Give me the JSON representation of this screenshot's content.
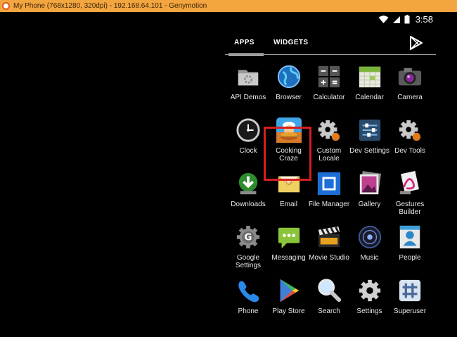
{
  "window": {
    "title": "My Phone (768x1280, 320dpi) - 192.168.64.101 - Genymotion"
  },
  "status_bar": {
    "time": "3:58"
  },
  "tabs": [
    {
      "label": "APPS"
    },
    {
      "label": "WIDGETS"
    }
  ],
  "apps": [
    {
      "label": "API Demos",
      "icon": "folder-icon"
    },
    {
      "label": "Browser",
      "icon": "globe-icon"
    },
    {
      "label": "Calculator",
      "icon": "calculator-icon"
    },
    {
      "label": "Calendar",
      "icon": "calendar-icon"
    },
    {
      "label": "Camera",
      "icon": "camera-icon"
    },
    {
      "label": "Clock",
      "icon": "clock-icon"
    },
    {
      "label": "Cooking Craze",
      "icon": "cooking-craze-icon"
    },
    {
      "label": "Custom Locale",
      "icon": "gear-icon"
    },
    {
      "label": "Dev Settings",
      "icon": "sliders-icon"
    },
    {
      "label": "Dev Tools",
      "icon": "gear-icon"
    },
    {
      "label": "Downloads",
      "icon": "download-icon"
    },
    {
      "label": "Email",
      "icon": "email-icon"
    },
    {
      "label": "File Manager",
      "icon": "file-manager-icon"
    },
    {
      "label": "Gallery",
      "icon": "gallery-icon"
    },
    {
      "label": "Gestures Builder",
      "icon": "gestures-icon"
    },
    {
      "label": "Google Settings",
      "icon": "google-settings-icon"
    },
    {
      "label": "Messaging",
      "icon": "messaging-icon"
    },
    {
      "label": "Movie Studio",
      "icon": "clapperboard-icon"
    },
    {
      "label": "Music",
      "icon": "music-icon"
    },
    {
      "label": "People",
      "icon": "people-icon"
    },
    {
      "label": "Phone",
      "icon": "phone-icon"
    },
    {
      "label": "Play Store",
      "icon": "play-store-icon"
    },
    {
      "label": "Search",
      "icon": "search-icon"
    },
    {
      "label": "Settings",
      "icon": "settings-icon"
    },
    {
      "label": "Superuser",
      "icon": "superuser-icon"
    }
  ],
  "highlighted_app": "Cooking Craze",
  "colors": {
    "title_bar": "#f3a540",
    "highlight": "#d61f1f"
  }
}
